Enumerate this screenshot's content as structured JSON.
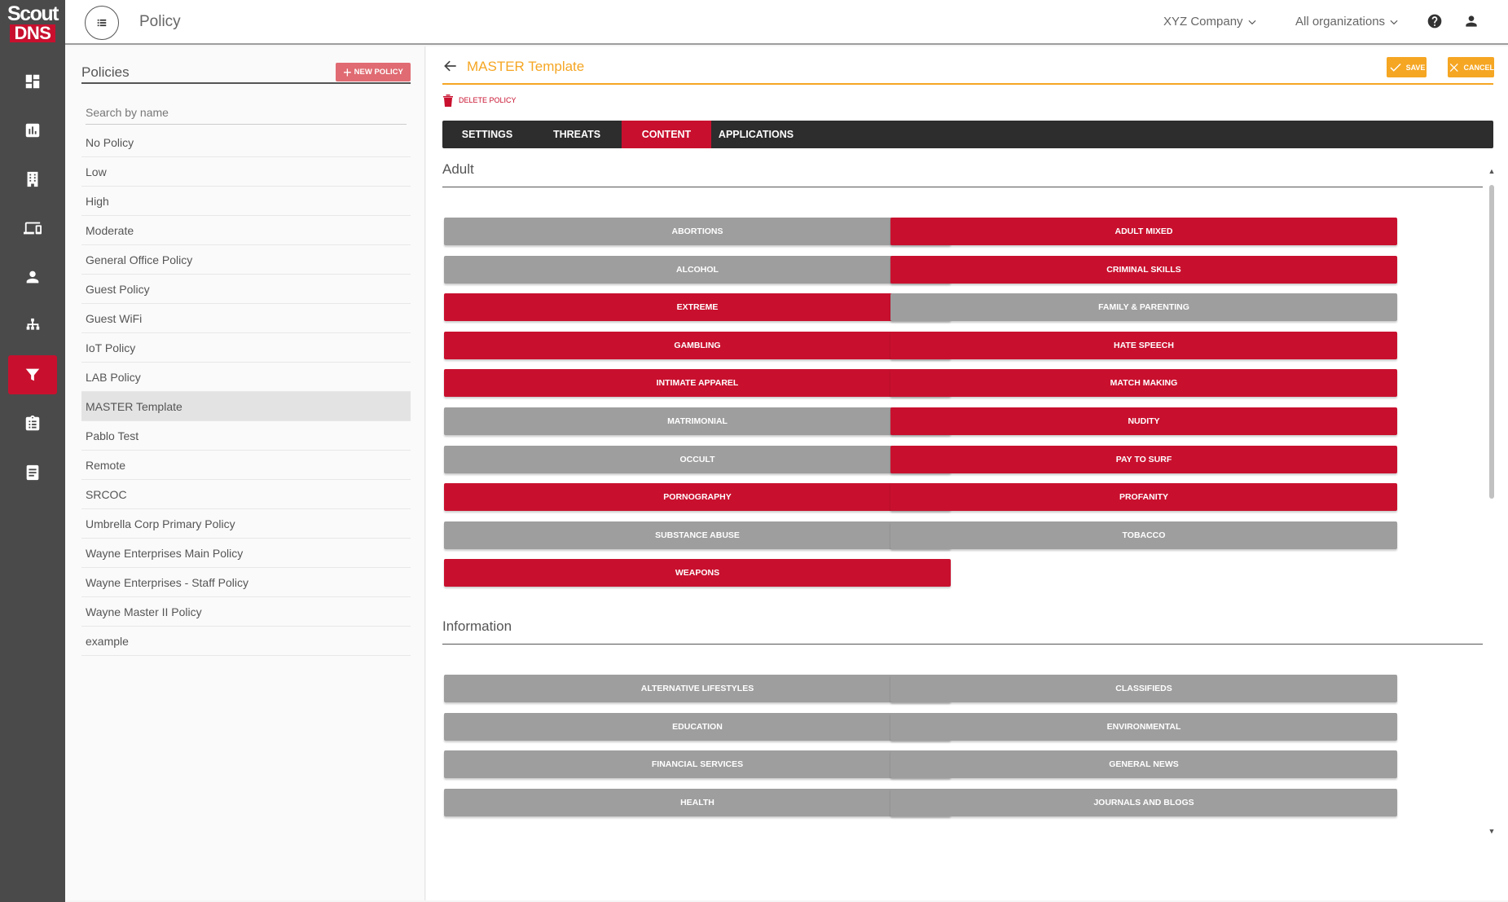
{
  "brand": {
    "line1": "Scout",
    "line2": "DNS"
  },
  "topbar": {
    "title": "Policy",
    "company": "XYZ Company",
    "orgs": "All organizations"
  },
  "nav": [
    "dashboard",
    "reports",
    "organizations",
    "devices",
    "users",
    "network",
    "policy",
    "logs",
    "docs"
  ],
  "left": {
    "title": "Policies",
    "new_label": "NEW POLICY",
    "search_placeholder": "Search by name",
    "policies": [
      "No Policy",
      "Low",
      "High",
      "Moderate",
      "General Office Policy",
      "Guest Policy",
      "Guest WiFi",
      "IoT Policy",
      "LAB Policy",
      "MASTER Template",
      "Pablo Test",
      "Remote",
      "SRCOC",
      "Umbrella Corp Primary Policy",
      "Wayne Enterprises Main Policy",
      "Wayne Enterprises - Staff Policy",
      "Wayne Master II Policy",
      "example"
    ],
    "selected": "MASTER Template"
  },
  "right": {
    "title": "MASTER Template",
    "save_label": "SAVE",
    "cancel_label": "CANCEL",
    "delete_label": "DELETE POLICY",
    "tabs": [
      "SETTINGS",
      "THREATS",
      "CONTENT",
      "APPLICATIONS"
    ],
    "active_tab": "CONTENT",
    "sections": [
      {
        "title": "Adult",
        "items": [
          {
            "label": "ABORTIONS",
            "on": false
          },
          {
            "label": "ADULT MIXED",
            "on": true
          },
          {
            "label": "ALCOHOL",
            "on": false
          },
          {
            "label": "CRIMINAL SKILLS",
            "on": true
          },
          {
            "label": "EXTREME",
            "on": true
          },
          {
            "label": "FAMILY & PARENTING",
            "on": false
          },
          {
            "label": "GAMBLING",
            "on": true
          },
          {
            "label": "HATE SPEECH",
            "on": true
          },
          {
            "label": "INTIMATE APPAREL",
            "on": true
          },
          {
            "label": "MATCH MAKING",
            "on": true
          },
          {
            "label": "MATRIMONIAL",
            "on": false
          },
          {
            "label": "NUDITY",
            "on": true
          },
          {
            "label": "OCCULT",
            "on": false
          },
          {
            "label": "PAY TO SURF",
            "on": true
          },
          {
            "label": "PORNOGRAPHY",
            "on": true
          },
          {
            "label": "PROFANITY",
            "on": true
          },
          {
            "label": "SUBSTANCE ABUSE",
            "on": false
          },
          {
            "label": "TOBACCO",
            "on": false
          },
          {
            "label": "WEAPONS",
            "on": true
          }
        ]
      },
      {
        "title": "Information",
        "items": [
          {
            "label": "ALTERNATIVE LIFESTYLES",
            "on": false
          },
          {
            "label": "CLASSIFIEDS",
            "on": false
          },
          {
            "label": "EDUCATION",
            "on": false
          },
          {
            "label": "ENVIRONMENTAL",
            "on": false
          },
          {
            "label": "FINANCIAL SERVICES",
            "on": false
          },
          {
            "label": "GENERAL NEWS",
            "on": false
          },
          {
            "label": "HEALTH",
            "on": false
          },
          {
            "label": "JOURNALS AND BLOGS",
            "on": false
          }
        ]
      }
    ]
  },
  "colors": {
    "accent": "#f5a623",
    "brand_red": "#c8102e",
    "inactive": "#9e9e9e",
    "sidebar": "#4a4a4a"
  }
}
